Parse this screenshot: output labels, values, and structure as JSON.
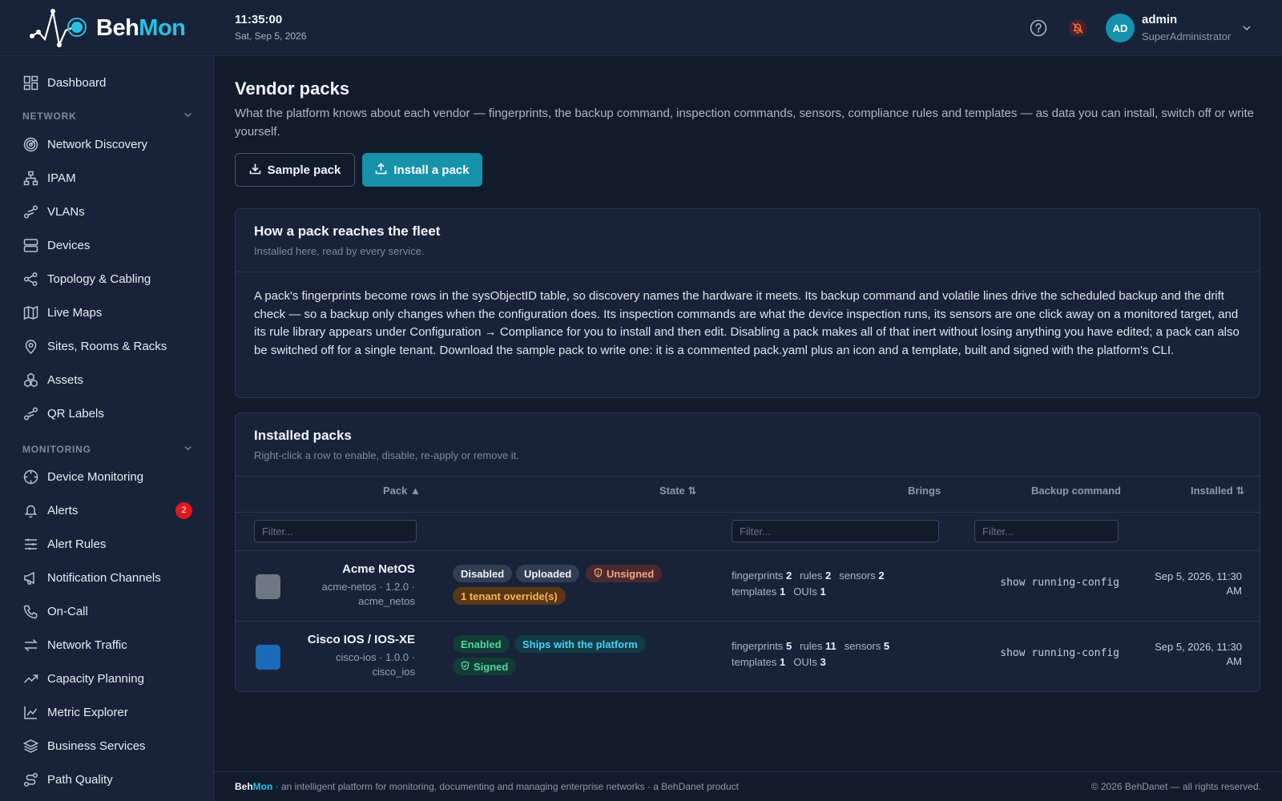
{
  "app": {
    "logo_a": "Beh",
    "logo_b": "Mon"
  },
  "header": {
    "time": "11:35:00",
    "date": "Sat, Sep 5, 2026",
    "avatar_initials": "AD",
    "user_name": "admin",
    "user_role": "SuperAdministrator"
  },
  "sidebar": {
    "dashboard": "Dashboard",
    "network_section": "NETWORK",
    "network": [
      "Network Discovery",
      "IPAM",
      "VLANs",
      "Devices",
      "Topology & Cabling",
      "Live Maps",
      "Sites, Rooms & Racks",
      "Assets",
      "QR Labels"
    ],
    "monitoring_section": "MONITORING",
    "monitoring": [
      "Device Monitoring",
      "Alerts",
      "Alert Rules",
      "Notification Channels",
      "On-Call",
      "Network Traffic",
      "Capacity Planning",
      "Metric Explorer",
      "Business Services",
      "Path Quality"
    ],
    "alerts_badge": "2"
  },
  "page": {
    "title": "Vendor packs",
    "description": "What the platform knows about each vendor — fingerprints, the backup command, inspection commands, sensors, compliance rules and templates — as data you can install, switch off or write yourself.",
    "sample_button": "Sample pack",
    "install_button": "Install a pack"
  },
  "how_card": {
    "title": "How a pack reaches the fleet",
    "subtitle": "Installed here, read by every service.",
    "body": "A pack's fingerprints become rows in the sysObjectID table, so discovery names the hardware it meets. Its backup command and volatile lines drive the scheduled backup and the drift check — so a backup only changes when the configuration does. Its inspection commands are what the device inspection runs, its sensors are one click away on a monitored target, and its rule library appears under Configuration → Compliance for you to install and then edit. Disabling a pack makes all of that inert without losing anything you have edited; a pack can also be switched off for a single tenant. Download the sample pack to write one: it is a commented pack.yaml plus an icon and a template, built and signed with the platform's CLI."
  },
  "packs_card": {
    "title": "Installed packs",
    "subtitle": "Right-click a row to enable, disable, re-apply or remove it.",
    "columns": {
      "pack": "Pack ▲",
      "state": "State ⇅",
      "brings": "Brings",
      "backup": "Backup command",
      "installed": "Installed ⇅"
    },
    "filter_placeholder": "Filter...",
    "rows": [
      {
        "name": "Acme NetOS",
        "meta1": "acme-netos · 1.2.0 ·",
        "meta2": "acme_netos",
        "icon_color": "#6f7783",
        "pills": [
          "Disabled",
          "Uploaded",
          "Unsigned",
          "1 tenant override(s)"
        ],
        "brings1": {
          "fingerprints": "2",
          "rules": "2",
          "sensors": "2"
        },
        "brings2": {
          "templates": "1",
          "OUIs": "1"
        },
        "backup": "show running-config",
        "installed": "Sep 5, 2026, 11:30 AM"
      },
      {
        "name": "Cisco IOS / IOS-XE",
        "meta1": "cisco-ios · 1.0.0 ·",
        "meta2": "cisco_ios",
        "icon_color": "#1c6bb8",
        "pills": [
          "Enabled",
          "Ships with the platform",
          "Signed"
        ],
        "brings1": {
          "fingerprints": "5",
          "rules": "11",
          "sensors": "5"
        },
        "brings2": {
          "templates": "1",
          "OUIs": "3"
        },
        "backup": "show running-config",
        "installed": "Sep 5, 2026, 11:30 AM"
      }
    ],
    "labels": {
      "fingerprints": "fingerprints",
      "rules": "rules",
      "sensors": "sensors",
      "templates": "templates",
      "ouis": "OUIs"
    }
  },
  "footer": {
    "brand_a": "Beh",
    "brand_b": "Mon",
    "tagline": " · an intelligent platform for monitoring, documenting and managing enterprise networks · a BehDanet product",
    "copyright": "© 2026 BehDanet — all rights reserved."
  }
}
